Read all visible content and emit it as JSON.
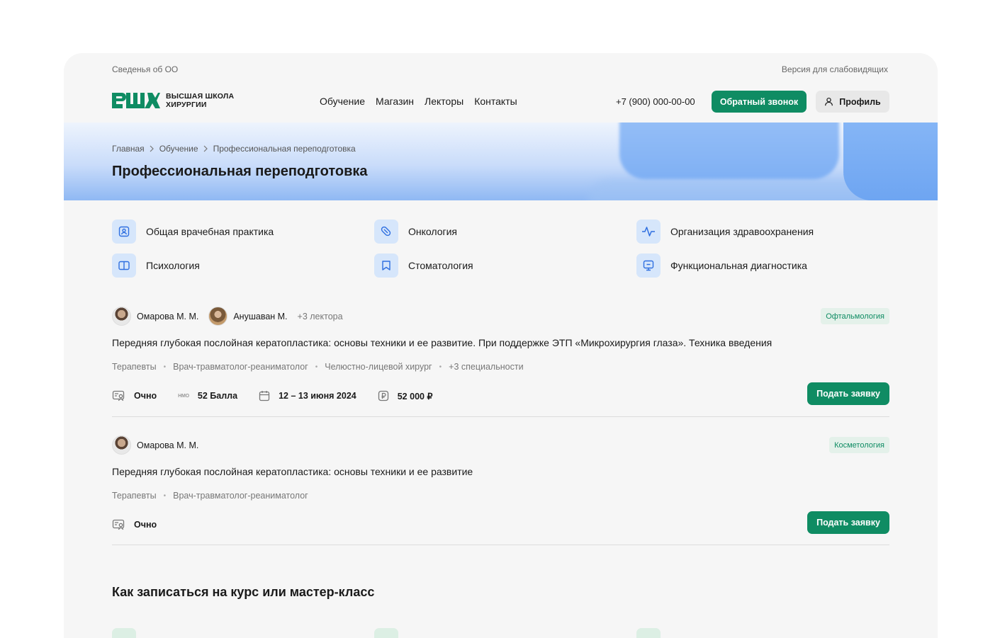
{
  "topbar": {
    "left": "Сведенья об ОО",
    "right": "Версия для слабовидящих"
  },
  "header": {
    "logo_line1": "ВЫСШАЯ ШКОЛА",
    "logo_line2": "ХИРУРГИИ",
    "nav": [
      "Обучение",
      "Магазин",
      "Лекторы",
      "Контакты"
    ],
    "phone": "+7 (900) 000-00-00",
    "callback": "Обратный звонок",
    "profile": "Профиль"
  },
  "hero": {
    "breadcrumb": [
      "Главная",
      "Обучение",
      "Профессиональная переподготовка"
    ],
    "title": "Профессиональная переподготовка"
  },
  "categories": [
    {
      "label": "Общая врачебная практика",
      "icon": "id-card-icon"
    },
    {
      "label": "Онкология",
      "icon": "pill-icon"
    },
    {
      "label": "Организация здравоохранения",
      "icon": "pulse-icon"
    },
    {
      "label": "Психология",
      "icon": "book-icon"
    },
    {
      "label": "Стоматология",
      "icon": "bookmark-icon"
    },
    {
      "label": "Функциональная диагностика",
      "icon": "monitor-icon"
    }
  ],
  "courses": [
    {
      "lecturers": [
        "Омарова М. М.",
        "Анушаван М."
      ],
      "more": "+3 лектора",
      "tag": "Офтальмология",
      "title": "Передняя глубокая послойная кератопластика: основы техники и ее развитие. При поддержке ЭТП «Микрохирургия глаза». Техника введения",
      "specs": [
        "Терапевты",
        "Врач-травматолог-реаниматолог",
        "Челюстно-лицевой хирург",
        "+3 специальности"
      ],
      "format": "Очно",
      "nmo_icon": "НМО",
      "points": "52 Балла",
      "dates": "12 – 13 июня 2024",
      "price": "52 000 ₽",
      "apply": "Подать заявку"
    },
    {
      "lecturers": [
        "Омарова М. М."
      ],
      "tag": "Косметология",
      "title": "Передняя глубокая послойная кератопластика: основы техники и ее развитие",
      "specs": [
        "Терапевты",
        "Врач-травматолог-реаниматолог"
      ],
      "format": "Очно",
      "apply": "Подать заявку"
    }
  ],
  "how": {
    "title": "Как записаться на курс или мастер-класс"
  },
  "colors": {
    "brand_green": "#0f8c63",
    "icon_blue": "#2f6fe0",
    "icon_bg": "#d6e6fb"
  }
}
